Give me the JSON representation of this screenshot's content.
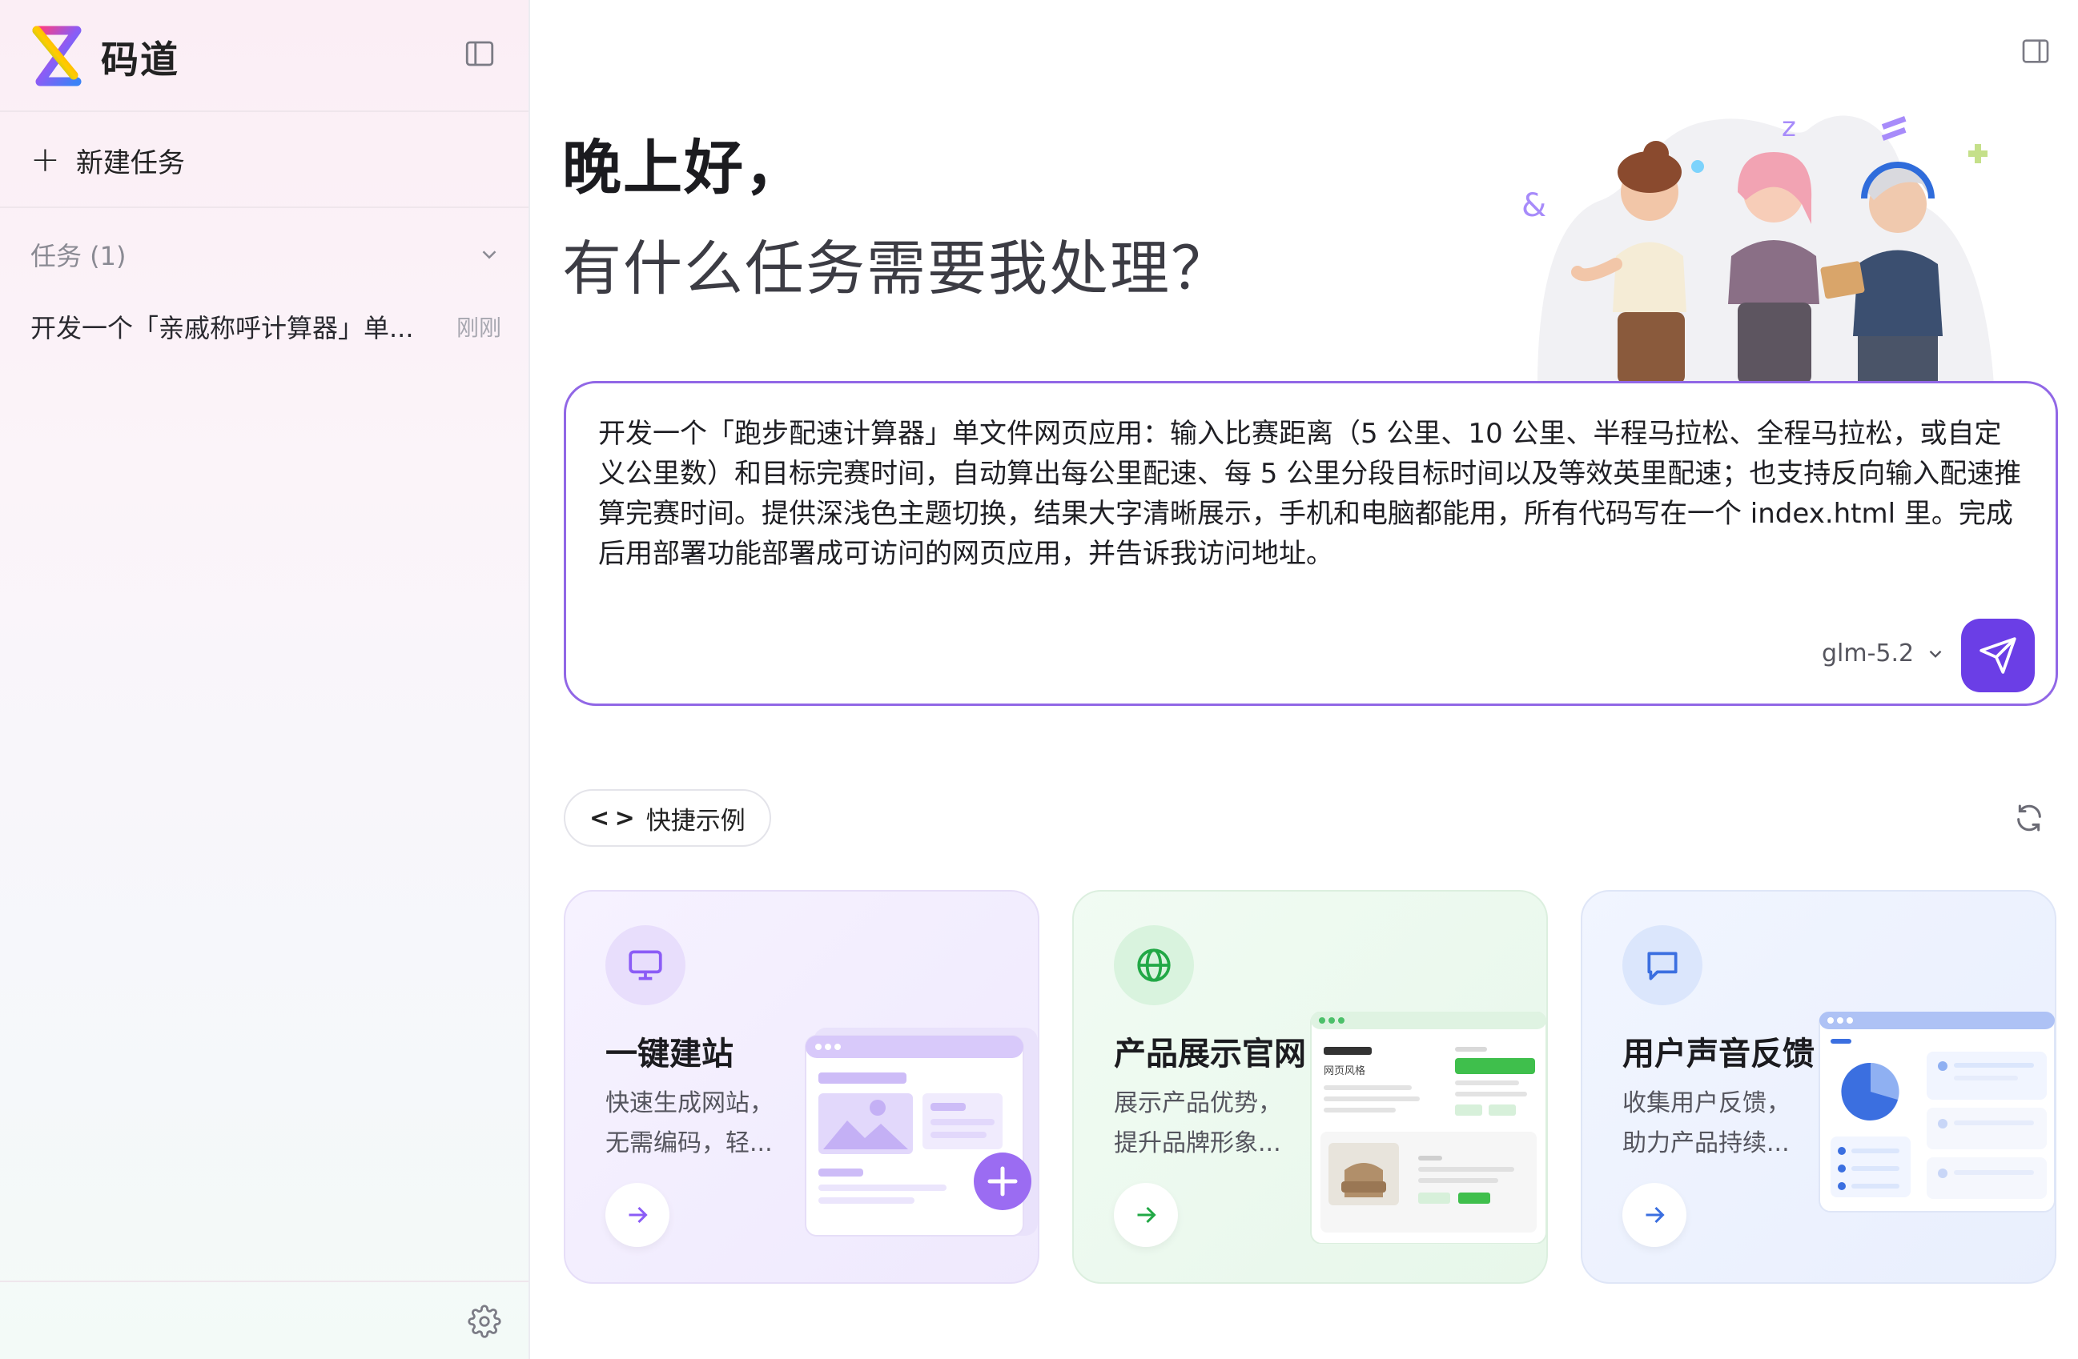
{
  "app": {
    "name": "码道"
  },
  "sidebar": {
    "new_task_label": "新建任务",
    "tasks_section_label": "任务 (1)",
    "tasks": [
      {
        "title": "开发一个「亲戚称呼计算器」单...",
        "time": "刚刚"
      }
    ]
  },
  "main": {
    "greeting": "晚上好，",
    "subgreeting": "有什么任务需要我处理？",
    "prompt": {
      "text": "开发一个「跑步配速计算器」单文件网页应用：输入比赛距离（5 公里、10 公里、半程马拉松、全程马拉松，或自定义公里数）和目标完赛时间，自动算出每公里配速、每 5 公里分段目标时间以及等效英里配速；也支持反向输入配速推算完赛时间。提供深浅色主题切换，结果大字清晰展示，手机和电脑都能用，所有代码写在一个 index.html 里。完成后用部署功能部署成可访问的网页应用，并告诉我访问地址。",
      "model": "glm-5.2"
    },
    "quick_examples_label": "快捷示例",
    "cards": [
      {
        "title": "一键建站",
        "desc_line1": "快速生成网站，",
        "desc_line2": "无需编码，轻...",
        "icon": "monitor-icon",
        "accent": "#8b5cf6"
      },
      {
        "title": "产品展示官网",
        "desc_line1": "展示产品优势，",
        "desc_line2": "提升品牌形象...",
        "icon": "globe-icon",
        "accent": "#22a846"
      },
      {
        "title": "用户声音反馈",
        "desc_line1": "收集用户反馈，",
        "desc_line2": "助力产品持续...",
        "icon": "chat-icon",
        "accent": "#3b6fe0"
      }
    ],
    "card2_mock_label": "网页风格"
  },
  "colors": {
    "accent": "#6b3ee6",
    "prompt_border": "#9167e6"
  }
}
